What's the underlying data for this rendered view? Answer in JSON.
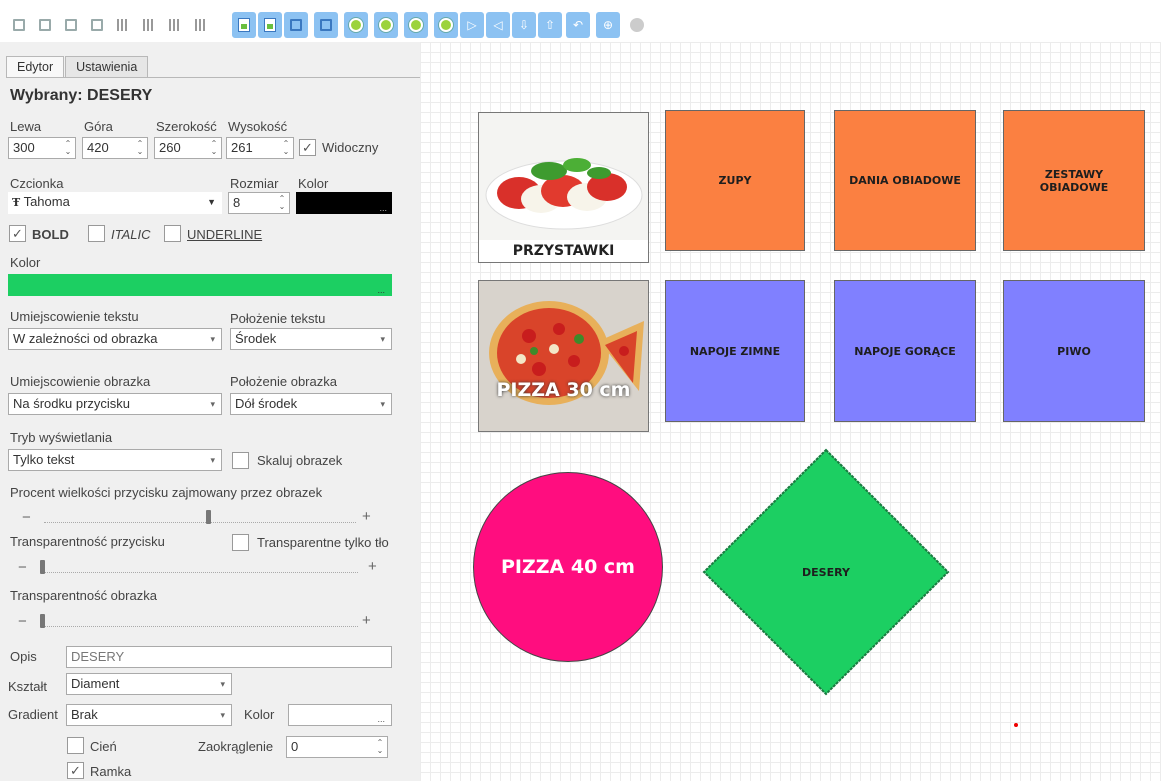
{
  "tabs": {
    "editor": "Edytor",
    "settings": "Ustawienia"
  },
  "selected_title": "Wybrany: DESERY",
  "position": {
    "left_label": "Lewa",
    "left_value": "300",
    "top_label": "Góra",
    "top_value": "420",
    "width_label": "Szerokość",
    "width_value": "260",
    "height_label": "Wysokość",
    "height_value": "261",
    "visible_label": "Widoczny",
    "visible_checked": true
  },
  "font": {
    "font_label": "Czcionka",
    "font_value": "Tahoma",
    "size_label": "Rozmiar",
    "size_value": "8",
    "color_label": "Kolor",
    "color_value": "#000000"
  },
  "style": {
    "bold": "BOLD",
    "italic": "ITALIC",
    "underline": "UNDERLINE"
  },
  "button_color": {
    "label": "Kolor",
    "value": "#1ccf62"
  },
  "text_placement": {
    "label": "Umiejscowienie tekstu",
    "value": "W zależności od obrazka",
    "pos_label": "Położenie tekstu",
    "pos_value": "Środek"
  },
  "image_placement": {
    "label": "Umiejscowienie obrazka",
    "value": "Na środku przycisku",
    "pos_label": "Położenie obrazka",
    "pos_value": "Dół środek"
  },
  "display": {
    "label": "Tryb wyświetlania",
    "value": "Tylko tekst",
    "scale_label": "Skaluj obrazek"
  },
  "image_percent": {
    "label": "Procent wielkości przycisku zajmowany przez obrazek",
    "level": 0.52
  },
  "button_transparency": {
    "label": "Transparentność  przycisku",
    "bg_only_label": "Transparentne tylko tło",
    "level": 0.0
  },
  "image_transparency": {
    "label": "Transparentność  obrazka",
    "level": 0.0
  },
  "description": {
    "label": "Opis",
    "value": "DESERY"
  },
  "shape": {
    "label": "Kształt",
    "value": "Diament"
  },
  "gradient": {
    "label": "Gradient",
    "value": "Brak",
    "color_label": "Kolor",
    "color_btn": "..."
  },
  "shadow_label": "Cień",
  "rounding": {
    "label": "Zaokrąglenie",
    "value": "0"
  },
  "frame_label": "Ramka",
  "canvas_buttons": {
    "przystawki": "PRZYSTAWKI",
    "zupy": "ZUPY",
    "dania": "DANIA OBIADOWE",
    "zestawy": "ZESTAWY OBIADOWE",
    "pizza30": "PIZZA 30 cm",
    "napoje_zimne": "NAPOJE ZIMNE",
    "napoje_gorace": "NAPOJE GORĄCE",
    "piwo": "PIWO",
    "pizza40": "PIZZA 40 cm",
    "desery": "DESERY"
  },
  "colors": {
    "orange": "#fb8041",
    "violet": "#8080ff",
    "pink": "#ff0d7f",
    "green": "#1ccf62"
  }
}
